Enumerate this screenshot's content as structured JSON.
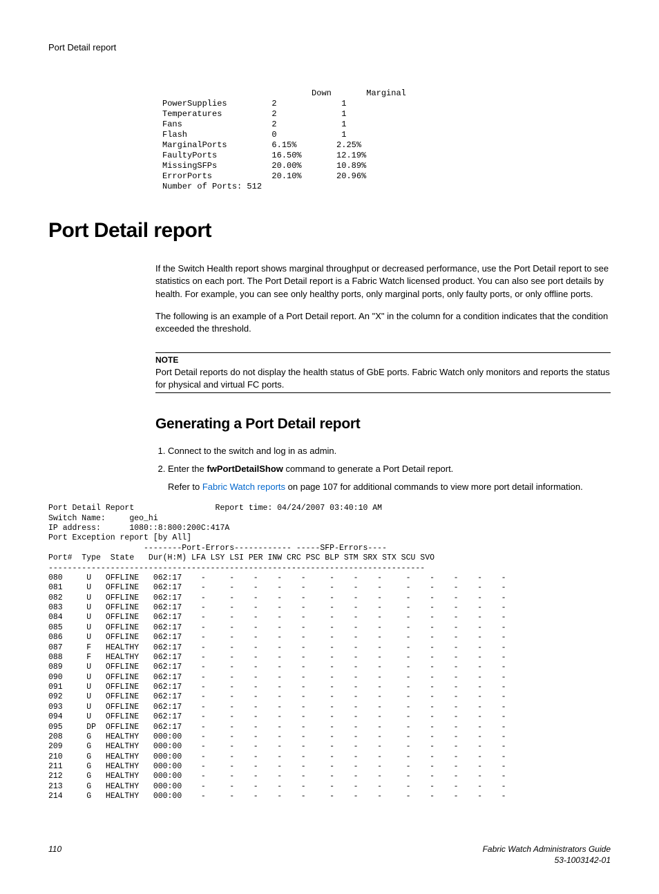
{
  "header": "Port Detail report",
  "topTable": "                              Down       Marginal\nPowerSupplies         2             1\nTemperatures          2             1\nFans                  2             1\nFlash                 0             1\nMarginalPorts         6.15%        2.25%\nFaultyPorts           16.50%       12.19%\nMissingSFPs           20.00%       10.89%\nErrorPorts            20.10%       20.96%\nNumber of Ports: 512",
  "h1": "Port Detail report",
  "para1": "If the Switch Health report shows marginal throughput or decreased performance, use the Port Detail report to see statistics on each port. The Port Detail report is a Fabric Watch licensed product. You can also see port details by health. For example, you can see only healthy ports, only marginal ports, only faulty ports, or only offline ports.",
  "para2": "The following is an example of a Port Detail report. An \"X\" in the column for a condition indicates that the condition exceeded the threshold.",
  "note": {
    "label": "NOTE",
    "text": "Port Detail reports do not display the health status of GbE ports. Fabric Watch only monitors and reports the status for physical and virtual FC ports."
  },
  "h2": "Generating a Port Detail report",
  "steps": {
    "s1": "Connect to the switch and log in as admin.",
    "s2a": "Enter the ",
    "s2cmd": "fwPortDetailShow",
    "s2b": " command to generate a Port Detail report.",
    "s2sub_a": "Refer to ",
    "s2sub_link": "Fabric Watch reports",
    "s2sub_b": " on page 107 for additional commands to view more port detail information."
  },
  "detailReport": "Port Detail Report                 Report time: 04/24/2007 03:40:10 AM\nSwitch Name:     geo_hi\nIP address:      1080::8:800:200C:417A\nPort Exception report [by All]\n                    --------Port-Errors------------ -----SFP-Errors----\nPort#  Type  State   Dur(H:M) LFA LSY LSI PER INW CRC PSC BLP STM SRX STX SCU SVO\n-------------------------------------------------------------------------------\n080     U   OFFLINE   062:17    -     -    -    -    -     -    -    -     -    -    -    -    -\n081     U   OFFLINE   062:17    -     -    -    -    -     -    -    -     -    -    -    -    -\n082     U   OFFLINE   062:17    -     -    -    -    -     -    -    -     -    -    -    -    -\n083     U   OFFLINE   062:17    -     -    -    -    -     -    -    -     -    -    -    -    -\n084     U   OFFLINE   062:17    -     -    -    -    -     -    -    -     -    -    -    -    -\n085     U   OFFLINE   062:17    -     -    -    -    -     -    -    -     -    -    -    -    -\n086     U   OFFLINE   062:17    -     -    -    -    -     -    -    -     -    -    -    -    -\n087     F   HEALTHY   062:17    -     -    -    -    -     -    -    -     -    -    -    -    -\n088     F   HEALTHY   062:17    -     -    -    -    -     -    -    -     -    -    -    -    -\n089     U   OFFLINE   062:17    -     -    -    -    -     -    -    -     -    -    -    -    -\n090     U   OFFLINE   062:17    -     -    -    -    -     -    -    -     -    -    -    -    -\n091     U   OFFLINE   062:17    -     -    -    -    -     -    -    -     -    -    -    -    -\n092     U   OFFLINE   062:17    -     -    -    -    -     -    -    -     -    -    -    -    -\n093     U   OFFLINE   062:17    -     -    -    -    -     -    -    -     -    -    -    -    -\n094     U   OFFLINE   062:17    -     -    -    -    -     -    -    -     -    -    -    -    -\n095     DP  OFFLINE   062:17    -     -    -    -    -     -    -    -     -    -    -    -    -\n208     G   HEALTHY   000:00    -     -    -    -    -     -    -    -     -    -    -    -    -\n209     G   HEALTHY   000:00    -     -    -    -    -     -    -    -     -    -    -    -    -\n210     G   HEALTHY   000:00    -     -    -    -    -     -    -    -     -    -    -    -    -\n211     G   HEALTHY   000:00    -     -    -    -    -     -    -    -     -    -    -    -    -\n212     G   HEALTHY   000:00    -     -    -    -    -     -    -    -     -    -    -    -    -\n213     G   HEALTHY   000:00    -     -    -    -    -     -    -    -     -    -    -    -    -\n214     G   HEALTHY   000:00    -     -    -    -    -     -    -    -     -    -    -    -    -",
  "footer": {
    "pageNum": "110",
    "title": "Fabric Watch Administrators Guide",
    "docId": "53-1003142-01"
  }
}
